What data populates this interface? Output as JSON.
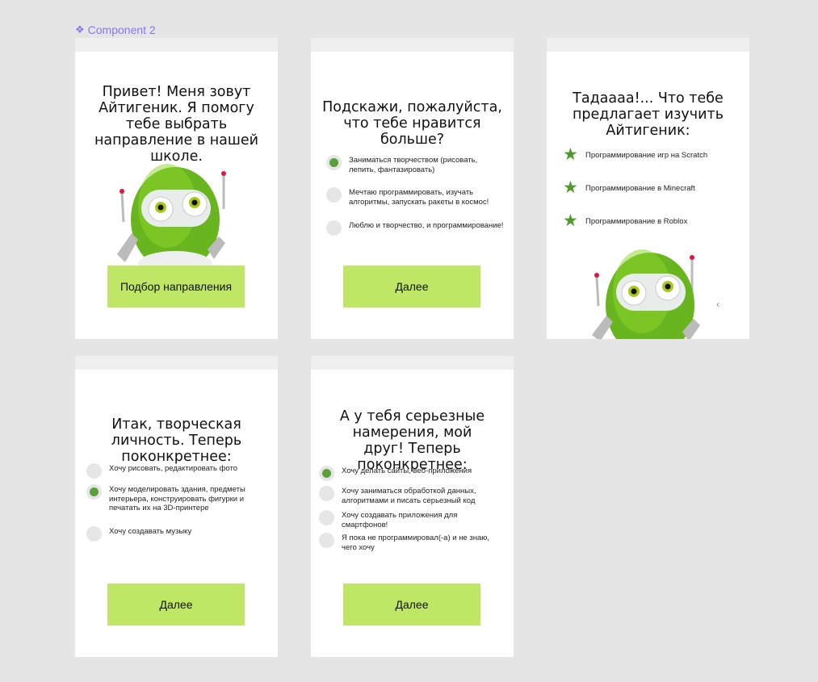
{
  "component_label": "Component 2",
  "card1": {
    "title": "Привет! Меня зовут Айтигеник. Я помогу тебе выбрать направление в нашей школе.",
    "button": "Подбор направления"
  },
  "card2": {
    "title": "Подскажи, пожалуйста, что тебе нравится больше?",
    "options": [
      {
        "text": "Заниматься творчеством (рисовать, лепить, фантазировать)",
        "selected": true
      },
      {
        "text": "Мечтаю программировать, изучать алгоритмы, запускать ракеты в космос!",
        "selected": false
      },
      {
        "text": "Люблю и творчество, и программирование!",
        "selected": false
      }
    ],
    "button": "Далее"
  },
  "card3": {
    "title": "Тадаааа!... Что тебе предлагает изучить Айтигеник:",
    "items": [
      "Программирование игр на Scratch",
      "Программирование в Minecraft",
      "Программирование в Roblox"
    ]
  },
  "card4": {
    "title": "Итак, творческая личность. Теперь поконкретнее:",
    "options": [
      {
        "text": "Хочу рисовать, редактировать фото",
        "selected": false
      },
      {
        "text": "Хочу моделировать здания, предметы интерьера, конструировать фигурки и печатать их на 3D-принтере",
        "selected": true
      },
      {
        "text": "Хочу создавать музыку",
        "selected": false
      }
    ],
    "button": "Далее"
  },
  "card5": {
    "title": "А у тебя серьезные намерения, мой друг! Теперь поконкретнее:",
    "options": [
      {
        "text": "Хочу делать сайты, веб-приложения",
        "selected": true
      },
      {
        "text": "Хочу заниматься обработкой данных, алгоритмами и писать серьезный код",
        "selected": false
      },
      {
        "text": "Хочу создавать приложения для смартфонов!",
        "selected": false
      },
      {
        "text": "Я пока не программировал(-а) и не знаю, чего хочу",
        "selected": false
      }
    ],
    "button": "Далее"
  },
  "colors": {
    "accent_button": "#bfe665",
    "radio_selected": "#5aa03a",
    "star": "#4f9a2f",
    "component_label": "#8a75f0"
  }
}
